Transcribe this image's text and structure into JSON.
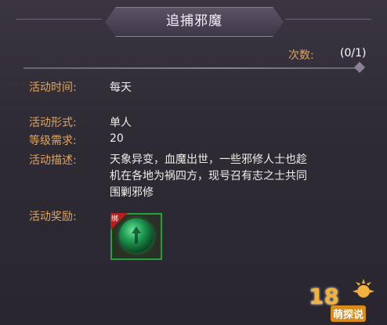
{
  "title": "追捕邪魔",
  "count": {
    "label": "次数:",
    "value": "(0/1)"
  },
  "rows": [
    {
      "label": "活动时间:",
      "value": "每天"
    },
    {
      "label": "活动形式:",
      "value": "单人"
    },
    {
      "label": "等级需求:",
      "value": "20"
    },
    {
      "label": "活动描述:",
      "value": ""
    },
    {
      "label": "活动奖励:",
      "value": ""
    }
  ],
  "description_lines": [
    "天象异变，血魔出世，一些邪修人士也趁",
    "机在各地为祸四方，现号召有志之士共同",
    "围剿邪修"
  ],
  "reward": {
    "tag": "绑",
    "icon": "green-orb-icon"
  },
  "watermark": {
    "num": "18",
    "text": "萌探说"
  },
  "colors": {
    "label": "#e1a55b",
    "value": "#f0ece8",
    "reward_border": "#1fa33a"
  }
}
